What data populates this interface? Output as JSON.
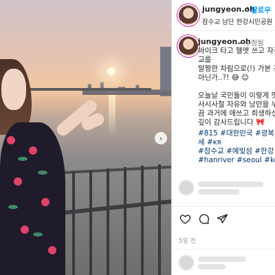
{
  "post": {
    "author": "jungyeon.oh",
    "follow_label": "팔로우",
    "separator": "•",
    "location": "잠수교 남단 한강시민공원",
    "edited_label": "• 수정됨",
    "caption_lines": [
      "바이크 타고 헬멧 쓰고 자주",
      "교를",
      "말짱한 차림으로(!) 가본 건",
      "아닌가..?! 😅 😊",
      "",
      "오늘날 국민들이 이렇게 멋",
      "사시사철 자유와 낭만을 누",
      "끔 과거에 애쓰고 희생하신",
      "깊이 감사드립니다 🎀"
    ],
    "hashtag_lines": [
      "#815 #대한민국 #광복절 #",
      "세 #ᴋʀ",
      "#잠수교 #예빛섬 #한강 #한",
      "#hanriver #seoul #korea"
    ],
    "date": "5일 전"
  },
  "icons": {
    "like": "heart-icon",
    "comment": "comment-icon",
    "share": "share-icon",
    "next": "chevron-right-icon"
  },
  "colors": {
    "link": "#00376b",
    "follow": "#0095f6",
    "ring": "#d6249f"
  }
}
